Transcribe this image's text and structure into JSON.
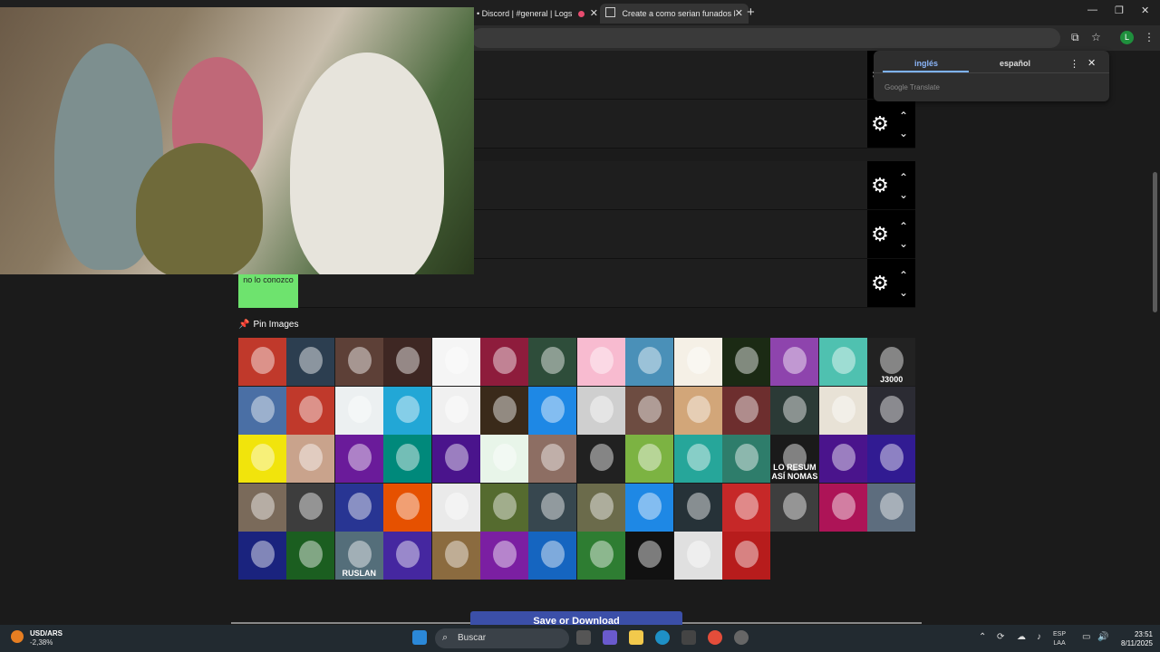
{
  "browser": {
    "tabs": [
      {
        "title": "• Discord | #general | Logs",
        "recording": true
      },
      {
        "title": "Create a como serian funados l"
      }
    ],
    "new_tab": "+",
    "window_controls": [
      "—",
      "❐",
      "✕"
    ],
    "profile_initial": "L"
  },
  "translate": {
    "source_lang": "inglés",
    "target_lang": "español",
    "footer": "Google Translate",
    "menu": "⋮",
    "close": "✕"
  },
  "tier_list": {
    "rows": 5,
    "green_tile_text": "no lo conozco",
    "gear": "⚙",
    "up": "⌃",
    "down": "⌄"
  },
  "pin_images": {
    "title": "Pin Images",
    "tile_labels": {
      "row3_col12": "LO RESUM ASÍ NOMAS",
      "row5_col3": "RUSLAN",
      "row1_col14": "J3000"
    },
    "tile_colors": [
      [
        "#c0392b",
        "#2c3e50",
        "#5d4037",
        "#3e2723",
        "#f5f5f5",
        "#8e1c3c",
        "#2e4d3a",
        "#f8bbd0",
        "#4a90b8",
        "#f5f0e6",
        "#1b2a14",
        "#8e44ad",
        "#4fc1b0",
        "#222"
      ],
      [
        "#4a6fa5",
        "#c0392b",
        "#ecf0f1",
        "#22a7d6",
        "#f0f0f0",
        "#3a2a1a",
        "#1e88e5",
        "#cfcfcf",
        "#6d4c41",
        "#d2a679",
        "#6d2e2e",
        "#2b3a36",
        "#e8e2d6",
        "#2b2b33"
      ],
      [
        "#f1e40c",
        "#c9a38c",
        "#6a1b9a",
        "#00897b",
        "#4a148c",
        "#e8f5e9",
        "#8d6e63",
        "#212121",
        "#7cb342",
        "#26a69a",
        "#2e7d6b",
        "#1a1a1a",
        "#4a148c",
        "#311b92"
      ],
      [
        "#7a6a5a",
        "#3d3d3d",
        "#283593",
        "#e65100",
        "#eaeaea",
        "#556b2f",
        "#37474f",
        "#6b6b4b",
        "#1e88e5",
        "#263238",
        "#c62828",
        "#3e3e3e",
        "#ad1457",
        "#5d6d7e"
      ],
      [
        "#1a237e",
        "#1b5e20",
        "#546e7a",
        "#4527a0",
        "#8b6b3f",
        "#7b1fa2",
        "#1565c0",
        "#2e7d32",
        "#111111",
        "#e0e0e0",
        "#b71c1c"
      ]
    ]
  },
  "save_button": "Save or Download",
  "taskbar": {
    "search_placeholder": "Buscar",
    "stock_name": "USD/ARS",
    "stock_change": "-2,38%",
    "language": "ESP",
    "keyboard": "LAA",
    "time": "23:51",
    "date": "8/11/2025"
  }
}
